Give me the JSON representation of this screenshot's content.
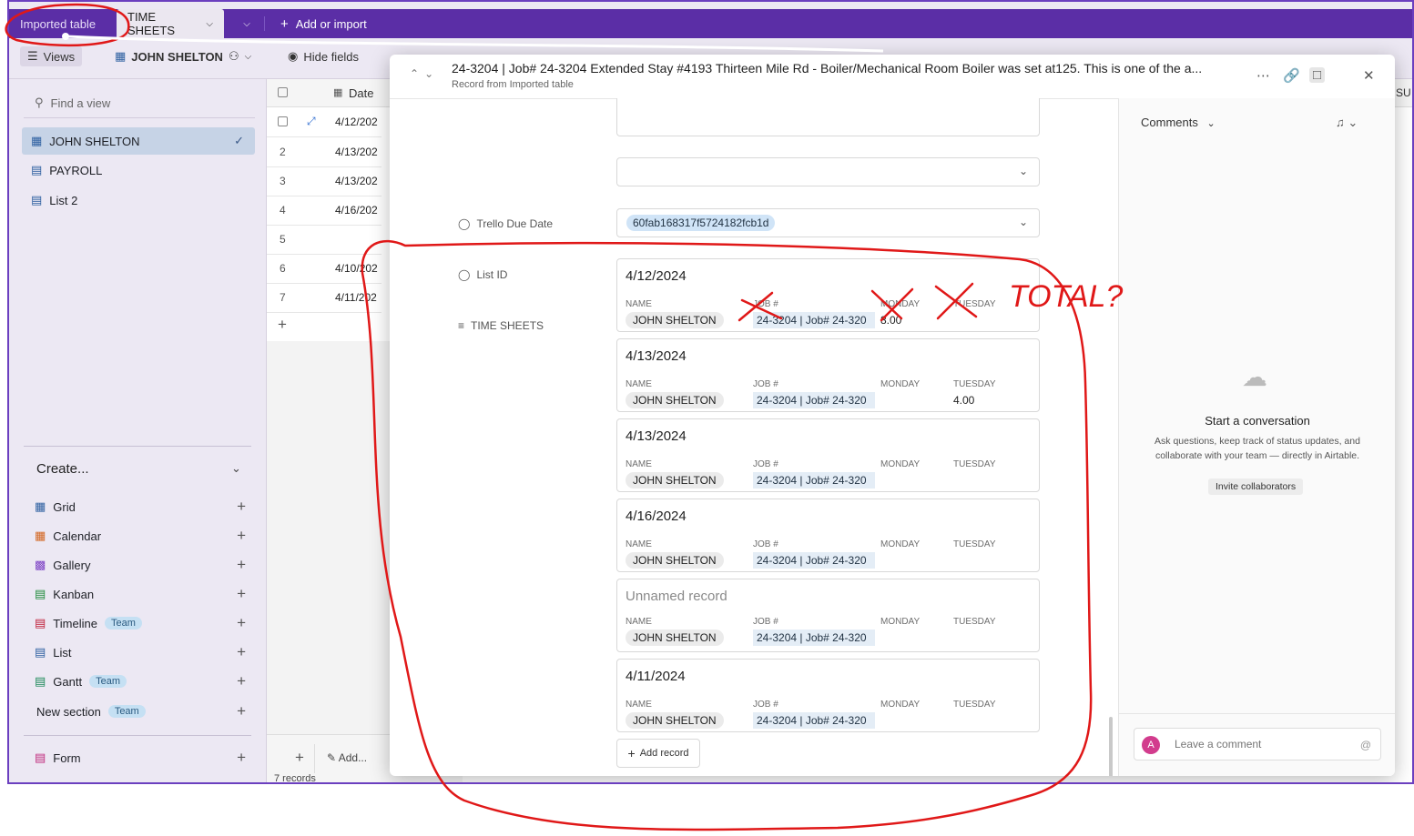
{
  "topbar": {
    "tab_imported": "Imported table",
    "tab_timesheets": "TIME SHEETS",
    "add_import": "Add or import"
  },
  "toolbar": {
    "views": "Views",
    "view_name": "JOHN SHELTON",
    "hide_fields": "Hide fields"
  },
  "sidebar": {
    "find_placeholder": "Find a view",
    "views": [
      {
        "label": "JOHN SHELTON"
      },
      {
        "label": "PAYROLL"
      },
      {
        "label": "List 2"
      }
    ],
    "create_label": "Create...",
    "create_items": [
      {
        "label": "Grid"
      },
      {
        "label": "Calendar"
      },
      {
        "label": "Gallery"
      },
      {
        "label": "Kanban"
      },
      {
        "label": "Timeline",
        "badge": "Team"
      },
      {
        "label": "List"
      },
      {
        "label": "Gantt",
        "badge": "Team"
      },
      {
        "label": "New section",
        "badge": "Team"
      },
      {
        "label": "Form"
      }
    ]
  },
  "grid": {
    "date_header": "Date",
    "right_header": "SU",
    "rows": [
      {
        "num": "",
        "date": "4/12/202"
      },
      {
        "num": "2",
        "date": "4/13/202"
      },
      {
        "num": "3",
        "date": "4/13/202"
      },
      {
        "num": "4",
        "date": "4/16/202"
      },
      {
        "num": "5",
        "date": ""
      },
      {
        "num": "6",
        "date": "4/10/202"
      },
      {
        "num": "7",
        "date": "4/11/202"
      }
    ],
    "add_label": "Add...",
    "record_count": "7 records"
  },
  "modal": {
    "title": "24-3204 | Job# 24-3204 Extended Stay #4193 Thirteen Mile Rd - Boiler/Mechanical Room Boiler was set at125. This is one of the a...",
    "subtitle": "Record from Imported table",
    "trello_label": "Trello Due Date",
    "listid_label": "List ID",
    "listid_value": "60fab168317f5724182fcb1d",
    "timesheets_label": "TIME SHEETS",
    "col_name": "NAME",
    "col_job": "JOB #",
    "col_monday": "MONDAY",
    "col_tuesday": "TUESDAY",
    "cards": [
      {
        "title": "4/12/2024",
        "name": "JOHN SHELTON",
        "job": "24-3204 | Job# 24-320",
        "monday": "8.00",
        "tuesday": ""
      },
      {
        "title": "4/13/2024",
        "name": "JOHN SHELTON",
        "job": "24-3204 | Job# 24-320",
        "monday": "",
        "tuesday": "4.00"
      },
      {
        "title": "4/13/2024",
        "name": "JOHN SHELTON",
        "job": "24-3204 | Job# 24-320",
        "monday": "",
        "tuesday": ""
      },
      {
        "title": "4/16/2024",
        "name": "JOHN SHELTON",
        "job": "24-3204 | Job# 24-320",
        "monday": "",
        "tuesday": ""
      },
      {
        "title": "Unnamed record",
        "name": "JOHN SHELTON",
        "job": "24-3204 | Job# 24-320",
        "monday": "",
        "tuesday": ""
      },
      {
        "title": "4/11/2024",
        "name": "JOHN SHELTON",
        "job": "24-3204 | Job# 24-320",
        "monday": "",
        "tuesday": ""
      }
    ],
    "add_record": "Add record"
  },
  "comments": {
    "header": "Comments",
    "empty_title": "Start a conversation",
    "empty_text": "Ask questions, keep track of status updates, and collaborate with your team — directly in Airtable.",
    "invite": "Invite collaborators",
    "avatar_letter": "A",
    "input_placeholder": "Leave a comment",
    "at_symbol": "@"
  },
  "annotation": {
    "text": "TOTAL?",
    "color": "#e01818"
  }
}
